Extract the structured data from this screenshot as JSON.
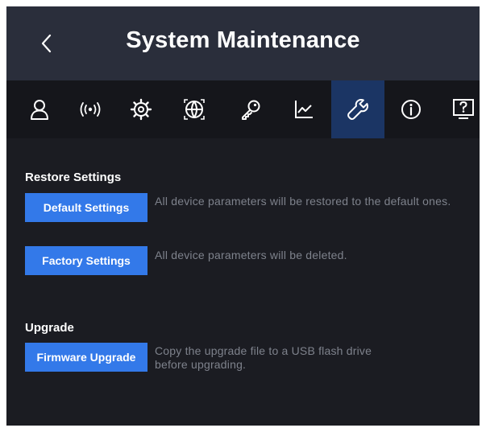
{
  "header": {
    "title": "System Maintenance",
    "back_icon": "chevron-left-icon"
  },
  "tabs": [
    {
      "icon": "user-icon",
      "active": false
    },
    {
      "icon": "wireless-icon",
      "active": false
    },
    {
      "icon": "gear-icon",
      "active": false
    },
    {
      "icon": "network-globe-icon",
      "active": false
    },
    {
      "icon": "key-icon",
      "active": false
    },
    {
      "icon": "line-chart-icon",
      "active": false
    },
    {
      "icon": "wrench-icon",
      "active": true
    },
    {
      "icon": "info-icon",
      "active": false
    },
    {
      "icon": "help-screen-icon",
      "active": false
    }
  ],
  "restore": {
    "title": "Restore Settings",
    "default_button": "Default Settings",
    "default_desc": "All device parameters will be restored to the default ones.",
    "factory_button": "Factory Settings",
    "factory_desc": "All device parameters will be deleted."
  },
  "upgrade": {
    "title": "Upgrade",
    "firmware_button": "Firmware Upgrade",
    "firmware_desc": "Copy the upgrade file to a USB flash drive before upgrading."
  },
  "colors": {
    "background": "#1b1c22",
    "header": "#2a2e3b",
    "tabbar": "#15161b",
    "active_tab": "#1b3564",
    "button": "#3379e9",
    "description": "#7e828c"
  }
}
